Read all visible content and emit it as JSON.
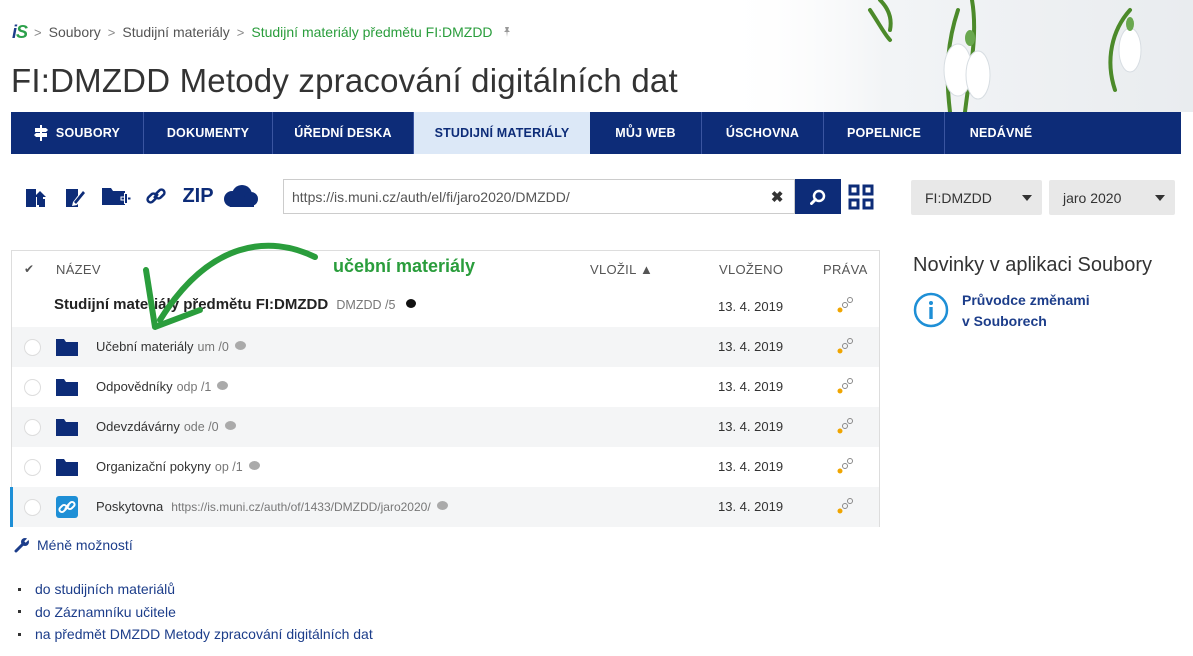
{
  "breadcrumb": {
    "logo": "IS",
    "items": [
      "Soubory",
      "Studijní materiály"
    ],
    "current": "Studijní materiály předmětu FI:DMZDD"
  },
  "page_title": "FI:DMZDD Metody zpracování digitálních dat",
  "nav": {
    "items": [
      "SOUBORY",
      "DOKUMENTY",
      "ÚŘEDNÍ DESKA",
      "STUDIJNÍ MATERIÁLY",
      "MŮJ WEB",
      "ÚSCHOVNA",
      "POPELNICE",
      "NEDÁVNÉ"
    ],
    "active": "STUDIJNÍ MATERIÁLY"
  },
  "toolbar": {
    "zip_label": "ZIP",
    "url_value": "https://is.muni.cz/auth/el/fi/jaro2020/DMZDD/",
    "clear_symbol": "✖",
    "icons": [
      "upload-file-icon",
      "edit-file-icon",
      "new-folder-icon",
      "link-icon",
      "zip",
      "cloud-icon",
      "search-icon",
      "grid-view-icon"
    ]
  },
  "selects": {
    "course": "FI:DMZDD",
    "term": "jaro 2020"
  },
  "table": {
    "headers": {
      "check": "✔",
      "name": "NÁZEV",
      "owner": "VLOŽIL ▲",
      "date": "VLOŽENO",
      "rights": "PRÁVA"
    },
    "parent": {
      "name": "Studijní materiály předmětu FI:DMZDD",
      "short": "DMZDD /5",
      "date": "13. 4. 2019"
    },
    "rows": [
      {
        "name": "Učební materiály",
        "short": "um /0",
        "date": "13. 4. 2019",
        "type": "folder"
      },
      {
        "name": "Odpovědníky",
        "short": "odp /1",
        "date": "13. 4. 2019",
        "type": "folder"
      },
      {
        "name": "Odevzdávárny",
        "short": "ode /0",
        "date": "13. 4. 2019",
        "type": "folder"
      },
      {
        "name": "Organizační pokyny",
        "short": "op /1",
        "date": "13. 4. 2019",
        "type": "folder"
      },
      {
        "name": "Poskytovna",
        "short": "https://is.muni.cz/auth/of/1433/DMZDD/jaro2020/",
        "date": "13. 4. 2019",
        "type": "link"
      }
    ]
  },
  "annotation": {
    "text": "učební materiály",
    "color": "#2a9d3c"
  },
  "news": {
    "title": "Novinky v aplikaci Soubory",
    "link_line1": "Průvodce změnami",
    "link_line2": "v Souborech"
  },
  "less_options": "Méně možností",
  "links": [
    "do studijních materiálů",
    "do Záznamníku učitele",
    "na předmět DMZDD Metody zpracování digitálních dat"
  ],
  "colors": {
    "nav_bg": "#0d2c78",
    "nav_active_bg": "#dce8f7",
    "link": "#1c3d8a",
    "brand_green": "#2a9d3c"
  }
}
